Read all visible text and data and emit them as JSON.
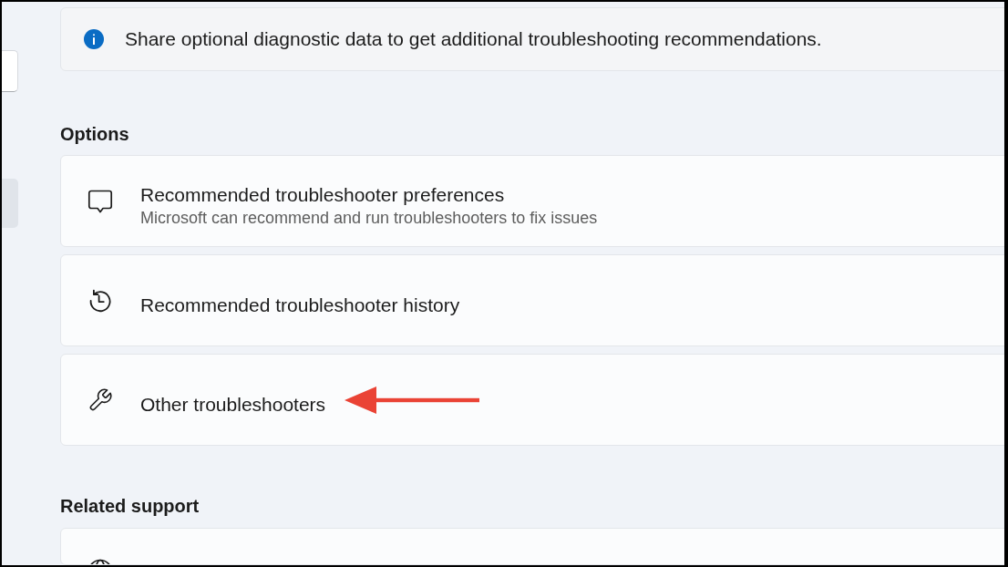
{
  "sidebar": {
    "search_field": true,
    "items": [
      {
        "selected": true
      }
    ]
  },
  "info_banner": {
    "text": "Share optional diagnostic data to get additional troubleshooting recommendations."
  },
  "options": {
    "heading": "Options",
    "items": [
      {
        "kind": "feedback",
        "title": "Recommended troubleshooter preferences",
        "subtitle": "Microsoft can recommend and run troubleshooters to fix issues",
        "pointed_at": false
      },
      {
        "kind": "history",
        "title": "Recommended troubleshooter history",
        "pointed_at": false
      },
      {
        "kind": "tools",
        "title": "Other troubleshooters",
        "pointed_at": true
      }
    ]
  },
  "related_support": {
    "heading": "Related support"
  }
}
